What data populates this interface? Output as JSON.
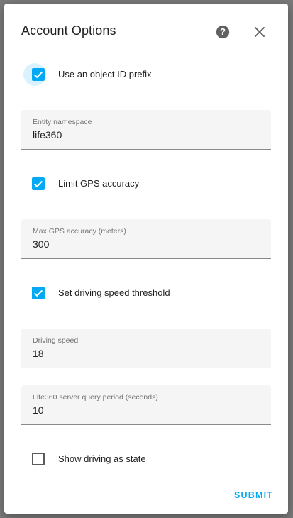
{
  "dialog": {
    "title": "Account Options",
    "help_icon": "help-circle-icon",
    "close_icon": "close-icon"
  },
  "options": {
    "object_id_prefix": {
      "label": "Use an object ID prefix",
      "checked": true
    },
    "entity_namespace": {
      "label": "Entity namespace",
      "value": "life360"
    },
    "limit_gps_accuracy": {
      "label": "Limit GPS accuracy",
      "checked": true
    },
    "max_gps_accuracy": {
      "label": "Max GPS accuracy (meters)",
      "value": "300"
    },
    "driving_speed_threshold": {
      "label": "Set driving speed threshold",
      "checked": true
    },
    "driving_speed": {
      "label": "Driving speed",
      "value": "18"
    },
    "query_period": {
      "label": "Life360 server query period (seconds)",
      "value": "10"
    },
    "show_driving": {
      "label": "Show driving as state",
      "checked": false
    }
  },
  "actions": {
    "submit_label": "SUBMIT"
  },
  "colors": {
    "accent": "#03a9f4",
    "field_background": "#f5f5f5",
    "text": "#212121"
  }
}
